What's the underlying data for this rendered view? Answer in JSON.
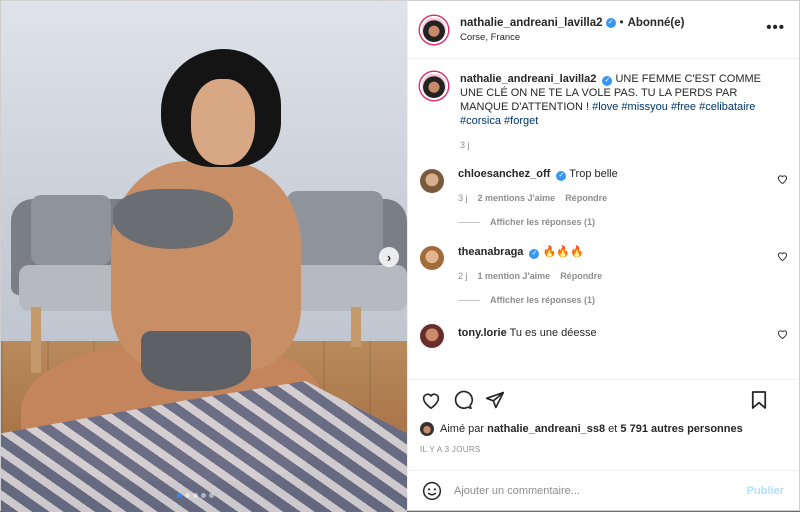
{
  "post": {
    "author": "nathalie_andreani_lavilla2",
    "follow_status": "Abonné(e)",
    "separator": "•",
    "location": "Corse, France",
    "caption_text": "UNE FEMME C'EST COMME UNE CLÉ ON NE TE LA VOLE PAS. TU LA PERDS PAR MANQUE D'ATTENTION !",
    "hashtags": [
      "#love",
      "#missyou",
      "#free",
      "#celibataire",
      "#corsica",
      "#forget"
    ],
    "caption_time": "3 j"
  },
  "comments": [
    {
      "user": "chloesanchez_off",
      "text": "Trop belle",
      "time": "3 j",
      "likes": "2 mentions J'aime",
      "reply": "Répondre",
      "show_replies": "Afficher les réponses (1)",
      "verified": true
    },
    {
      "user": "theanabraga",
      "text": "🔥🔥🔥",
      "time": "2 j",
      "likes": "1 mention J'aime",
      "reply": "Répondre",
      "show_replies": "Afficher les réponses (1)",
      "verified": true
    },
    {
      "user": "tony.lorie",
      "text": "Tu es une déesse",
      "verified": false
    }
  ],
  "likes": {
    "prefix": "Aimé par",
    "user": "nathalie_andreani_ss8",
    "conj": "et",
    "others": "5 791 autres personnes"
  },
  "time_ago": "IL Y A 3 JOURS",
  "add_comment": {
    "placeholder": "Ajouter un commentaire...",
    "publish": "Publier"
  },
  "icons": {
    "more": "more-options-icon",
    "next": "chevron-right-icon",
    "heart": "heart-icon",
    "comment": "comment-icon",
    "share": "share-icon",
    "bookmark": "bookmark-icon",
    "emoji": "emoji-icon"
  },
  "colors": {
    "accent": "#3897f0",
    "hashtag": "#00376b",
    "muted": "#8e8e8e",
    "publish_disabled": "#b2dffc"
  }
}
